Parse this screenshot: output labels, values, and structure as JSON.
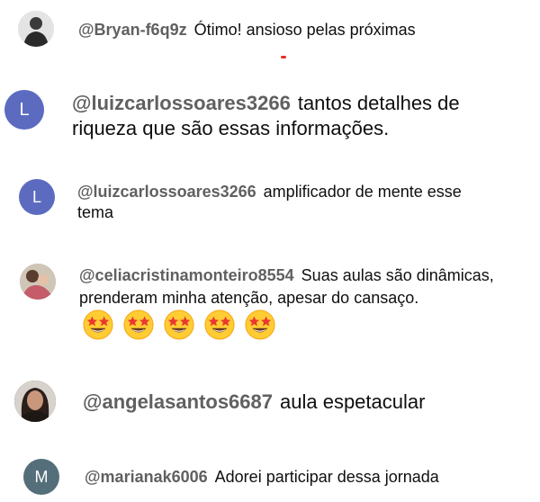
{
  "comments": [
    {
      "author": "@Bryan-f6q9z",
      "text": "Ótimo! ansioso pelas próximas",
      "avatar": {
        "type": "photo",
        "color": "#6f6f6f"
      }
    },
    {
      "author": "@luizcarlossoares3266",
      "text": "tantos detalhes de riqueza que são essas informações.",
      "avatar": {
        "type": "letter",
        "letter": "L",
        "color": "#5c6bc0"
      }
    },
    {
      "author": "@luizcarlossoares3266",
      "text": "amplificador de mente esse tema",
      "avatar": {
        "type": "letter",
        "letter": "L",
        "color": "#5c6bc0"
      }
    },
    {
      "author": "@celiacristinamonteiro8554",
      "text": "Suas aulas são dinâmicas, prenderam minha atenção, apesar do cansaço.",
      "avatar": {
        "type": "photo",
        "color": "#b48a7a"
      },
      "emojis": [
        "star-struck",
        "star-struck",
        "star-struck",
        "star-struck",
        "star-struck"
      ]
    },
    {
      "author": "@angelasantos6687",
      "text": "aula espetacular",
      "avatar": {
        "type": "photo",
        "color": "#3a2c28"
      }
    },
    {
      "author": "@marianak6006",
      "text": "Adorei participar dessa jornada",
      "avatar": {
        "type": "letter",
        "letter": "M",
        "color": "#546e7a"
      }
    }
  ],
  "accent_color": "#e52d27",
  "emoji_name": "star-struck-emoji"
}
